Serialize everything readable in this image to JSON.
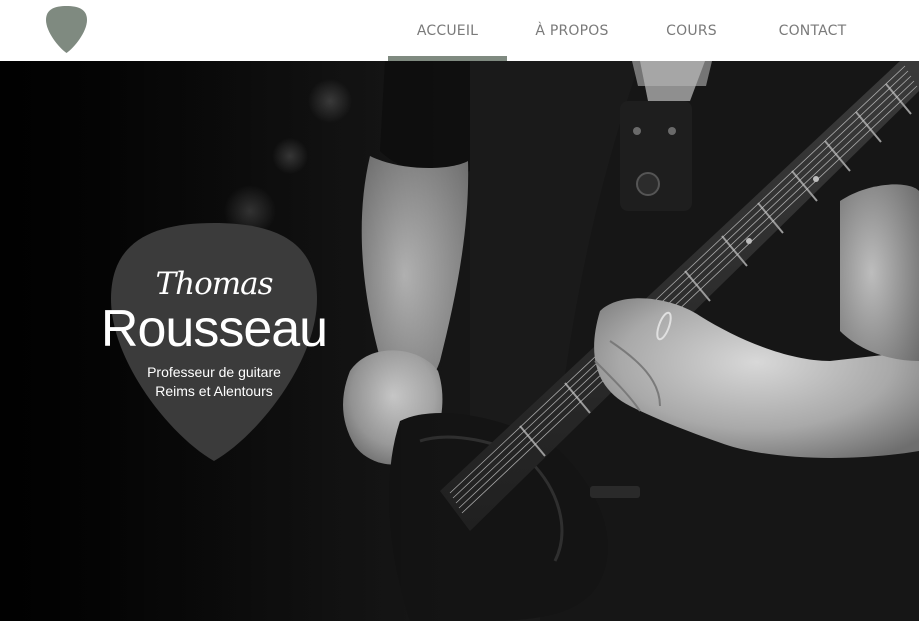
{
  "header": {
    "logo_icon": "guitar-pick-icon",
    "logo_color": "#7f8a80"
  },
  "nav": {
    "items": [
      {
        "label": "ACCUEIL",
        "active": true
      },
      {
        "label": "À PROPOS",
        "active": false
      },
      {
        "label": "COURS",
        "active": false
      },
      {
        "label": "CONTACT",
        "active": false
      }
    ],
    "active_indicator_color": "#7f8a80",
    "text_color": "#7a7a7a"
  },
  "hero": {
    "image": "guitarist-playing-electric-guitar-monochrome",
    "pick": {
      "first_name": "Thomas",
      "last_name": "Rousseau",
      "subtitle_line1": "Professeur de guitare",
      "subtitle_line2": "Reims et Alentours",
      "color": "#3b3b3b"
    }
  }
}
